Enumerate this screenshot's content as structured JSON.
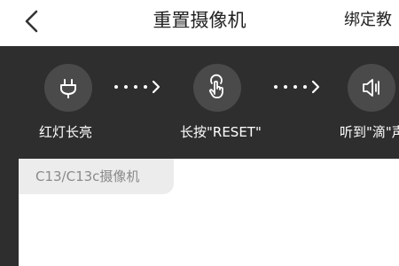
{
  "header": {
    "title": "重置摄像机",
    "action_label": "绑定教"
  },
  "steps": [
    {
      "label": "红灯长亮",
      "icon": "plug-icon"
    },
    {
      "label": "长按\"RESET\"",
      "icon": "hand-tap-icon"
    },
    {
      "label": "听到\"滴\"声",
      "icon": "speaker-icon"
    }
  ],
  "card": {
    "tab_label": "C13/C13c摄像机"
  },
  "colors": {
    "panel_bg": "#2e2e2e",
    "circle_bg": "#4a4a4a",
    "tab_bg": "#ececec"
  }
}
